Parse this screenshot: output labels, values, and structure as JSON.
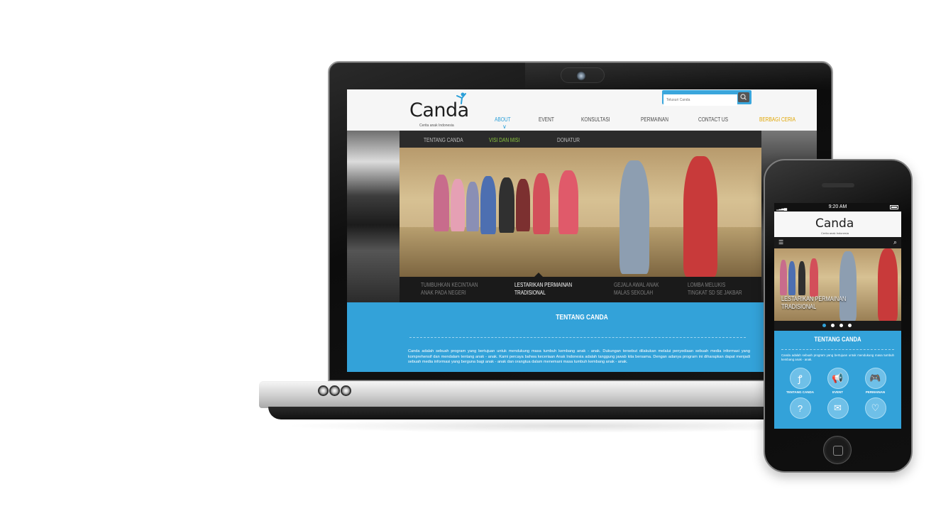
{
  "laptop": {
    "header": {
      "logo_text": "Canda",
      "logo_tagline": "Cerita anak Indonesia",
      "search_placeholder": "Telusuri Canda",
      "nav": [
        "ABOUT",
        "EVENT",
        "KONSULTASI",
        "PERMAINAN",
        "CONTACT US",
        "BERBAGI CERIA"
      ],
      "active_nav": "ABOUT"
    },
    "subnav": [
      "TENTANG CANDA",
      "VISI DAN MISI",
      "DONATUR"
    ],
    "active_subnav": "VISI DAN MISI",
    "hero_captions": [
      "TUMBUHKAN KECINTAAN\nANAK PADA NEGERI",
      "LESTARIKAN PERMAINAN\nTRADISIONAL",
      "GEJALA AWAL ANAK\nMALAS SEKOLAH",
      "LOMBA MELUKIS\nTINGKAT SD SE JAKBAR"
    ],
    "about": {
      "title": "TENTANG CANDA",
      "text": "Canda adalah sebuah program yang bertujuan untuk mendukung masa tumbuh kembang anak - anak. Dukungan tersebut dilakukan melalui penyediaan sebuah media informasi yang komprehensif dan mendalam tentang anak - anak. Kami percaya bahwa keceriaan Anak Indonesia adalah tanggung jawab kita bersama. Dengan adanya program ini diharapkan dapat menjadi sebuah media informasi yang berguna bagi anak - anak dan orangtua dalam menemani masa tumbuh kembang anak - anak."
    }
  },
  "phone": {
    "status_time": "9:20 AM",
    "logo_text": "Canda",
    "logo_tagline": "Cerita anak Indonesia",
    "hero_caption": "LESTARIKAN PERMAINAN\nTRADISIONAL",
    "about": {
      "title": "TENTANG CANDA",
      "text": "Canda adalah sebuah program yang bertujuan untuk mendukung masa tumbuh kembang anak - anak."
    },
    "icons": [
      {
        "icon": "figure-icon",
        "label": "TENTANG CANDA",
        "glyph": "ꝭ"
      },
      {
        "icon": "megaphone-icon",
        "label": "EVENT",
        "glyph": "📢"
      },
      {
        "icon": "gamepad-icon",
        "label": "PERMAINAN",
        "glyph": "🎮"
      },
      {
        "icon": "question-icon",
        "label": "",
        "glyph": "?"
      },
      {
        "icon": "ticket-icon",
        "label": "",
        "glyph": "✉"
      },
      {
        "icon": "heart-icon",
        "label": "",
        "glyph": "♡"
      }
    ]
  },
  "colors": {
    "brand_blue": "#33a2d9",
    "active_green": "#8cc63f",
    "highlight_gold": "#e0a500"
  }
}
